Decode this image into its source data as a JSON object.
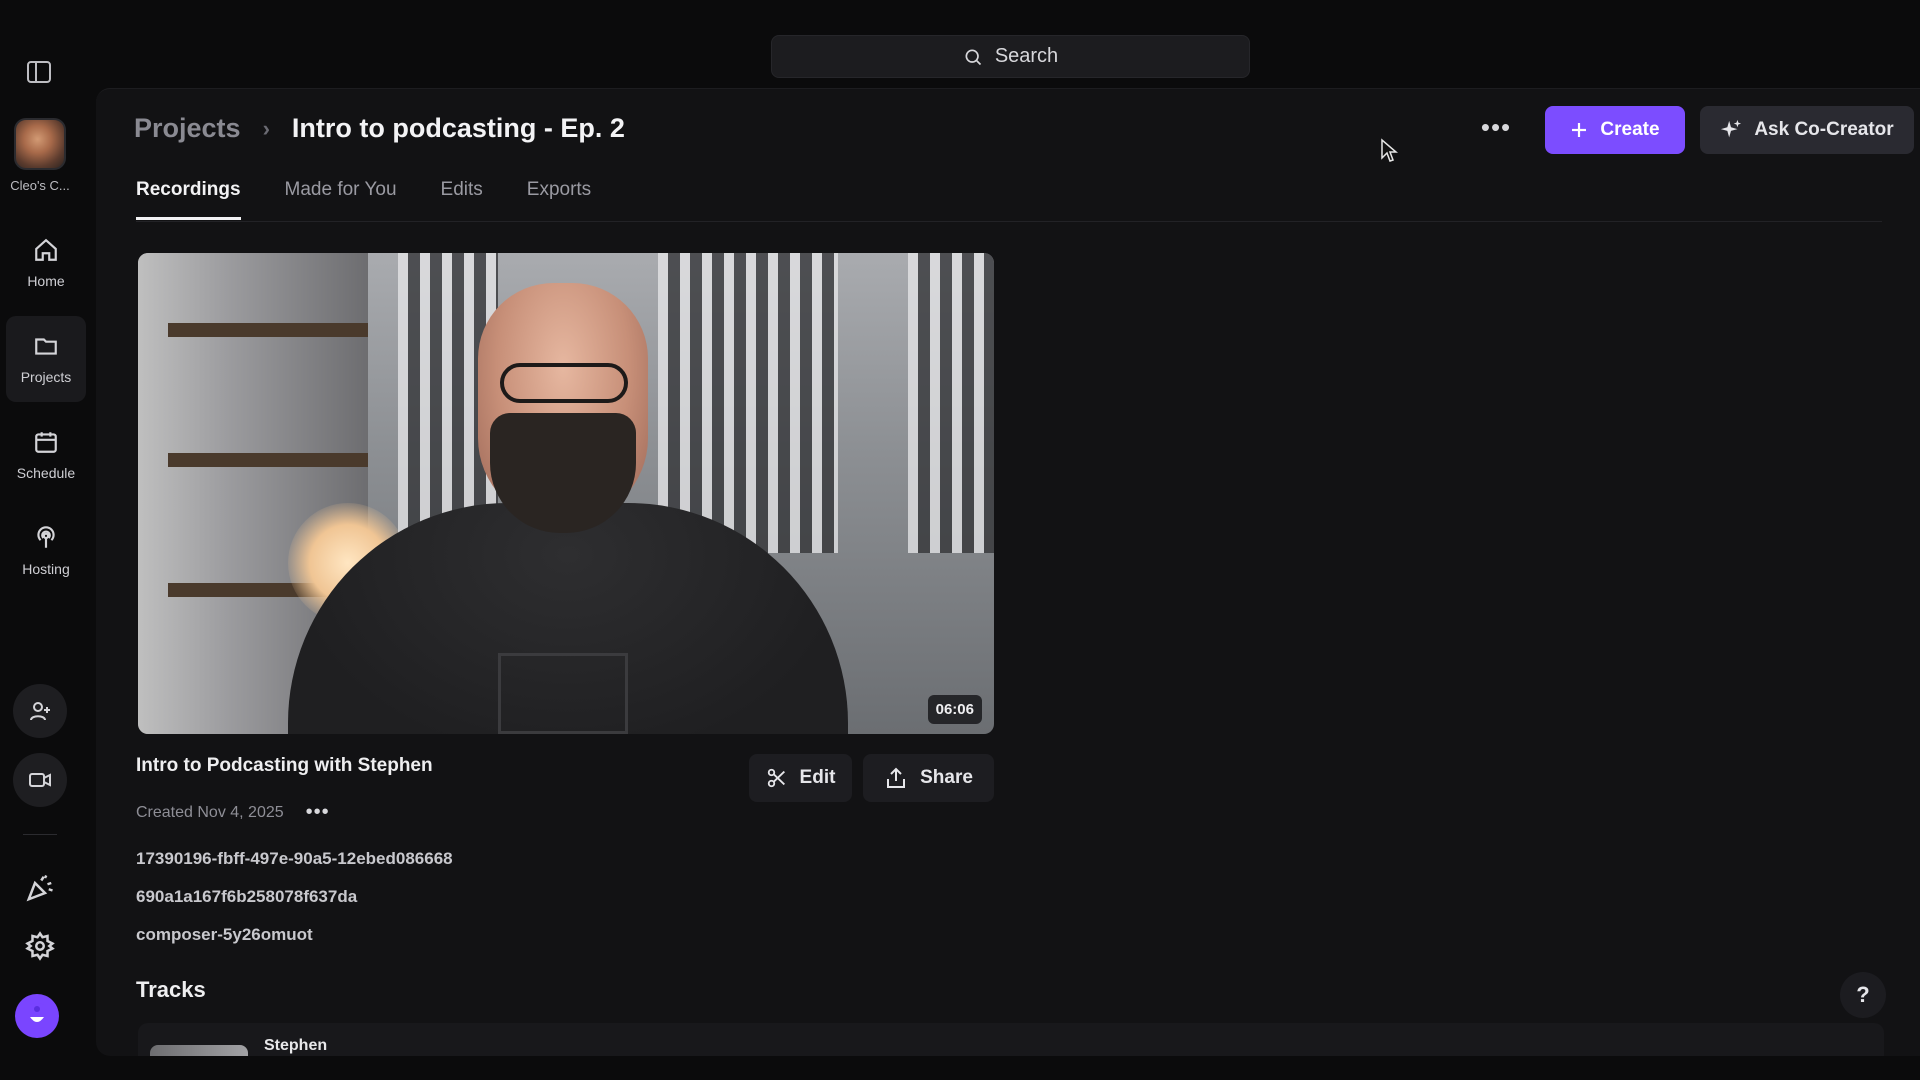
{
  "search": {
    "placeholder": "Search"
  },
  "sidebar": {
    "workspace_label": "Cleo's C...",
    "items": [
      {
        "label": "Home",
        "icon": "home-icon"
      },
      {
        "label": "Projects",
        "icon": "folder-icon"
      },
      {
        "label": "Schedule",
        "icon": "calendar-icon"
      },
      {
        "label": "Hosting",
        "icon": "podcast-icon"
      }
    ],
    "bottom_icons": [
      "add-user-icon",
      "video-camera-icon",
      "party-popper-icon",
      "gear-icon",
      "user-avatar-icon"
    ]
  },
  "header": {
    "breadcrumb_parent": "Projects",
    "breadcrumb_separator": "›",
    "breadcrumb_current": "Intro to podcasting - Ep. 2",
    "more_label": "•••",
    "create_label": "Create",
    "ask_label": "Ask Co-Creator"
  },
  "tabs": [
    {
      "label": "Recordings",
      "active": true
    },
    {
      "label": "Made for You",
      "active": false
    },
    {
      "label": "Edits",
      "active": false
    },
    {
      "label": "Exports",
      "active": false
    }
  ],
  "recording": {
    "duration": "06:06",
    "title": "Intro to Podcasting with Stephen",
    "created": "Created Nov 4, 2025",
    "more_label": "•••",
    "edit_label": "Edit",
    "share_label": "Share",
    "ids": [
      "17390196-fbff-497e-90a5-12ebed086668",
      "690a1a167f6b258078f637da",
      "composer-5y26omuot"
    ]
  },
  "tracks": {
    "title": "Tracks",
    "items": [
      {
        "name": "Stephen"
      }
    ]
  },
  "help_label": "?",
  "colors": {
    "accent": "#7c4dff",
    "background": "#121214",
    "sidebar": "#0b0b0c"
  }
}
